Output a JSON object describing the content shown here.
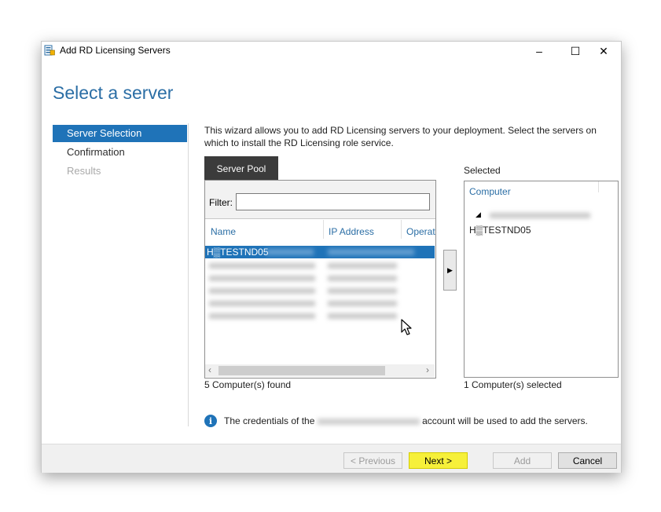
{
  "window": {
    "title": "Add RD Licensing Servers",
    "controls": {
      "minimize": "–",
      "maximize": "☐",
      "close": "✕"
    }
  },
  "page": {
    "heading": "Select a server",
    "intro": "This wizard allows you to add RD Licensing servers to your deployment. Select the servers on which to install the RD Licensing role service."
  },
  "nav": {
    "items": [
      {
        "label": "Server Selection",
        "state": "selected"
      },
      {
        "label": "Confirmation",
        "state": "normal"
      },
      {
        "label": "Results",
        "state": "disabled"
      }
    ]
  },
  "server_pool": {
    "tab_label": "Server Pool",
    "filter_label": "Filter:",
    "filter_value": "",
    "columns": [
      "Name",
      "IP Address",
      "Operat"
    ],
    "rows": [
      {
        "name": "H▒TESTND05",
        "ip": "",
        "os": "",
        "selected": true
      },
      {
        "name": "",
        "ip": "",
        "os": "",
        "selected": false
      },
      {
        "name": "",
        "ip": "",
        "os": "",
        "selected": false
      },
      {
        "name": "",
        "ip": "",
        "os": "",
        "selected": false
      },
      {
        "name": "",
        "ip": "",
        "os": "",
        "selected": false
      },
      {
        "name": "",
        "ip": "",
        "os": "",
        "selected": false
      }
    ],
    "found_text": "5 Computer(s) found",
    "scroll_left": "‹",
    "scroll_right": "›"
  },
  "add_arrow": "▶",
  "selected_panel": {
    "label": "Selected",
    "column": "Computer",
    "group_arrow": "◢",
    "items": [
      "H▒TESTND05"
    ],
    "count_text": "1 Computer(s) selected"
  },
  "info": {
    "icon": "i",
    "text_before": "The credentials of the",
    "text_after": "account will be used to add the servers."
  },
  "buttons": {
    "previous": "< Previous",
    "next": "Next >",
    "add": "Add",
    "cancel": "Cancel"
  },
  "colors": {
    "accent": "#1f73b8",
    "heading": "#2b6ea5",
    "highlight": "#f6f03a"
  }
}
